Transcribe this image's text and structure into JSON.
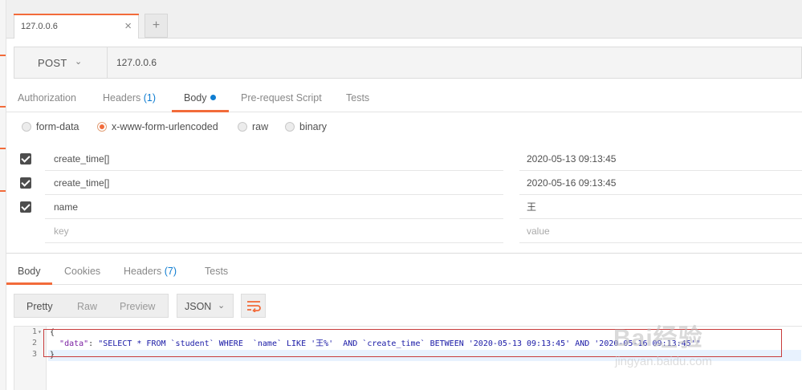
{
  "tabbar": {
    "active_tab": "127.0.0.6",
    "close_glyph": "×",
    "new_tab_glyph": "+"
  },
  "request": {
    "method": "POST",
    "url": "127.0.0.6",
    "tabs": [
      {
        "label": "Authorization"
      },
      {
        "label": "Headers",
        "count": "(1)"
      },
      {
        "label": "Body",
        "active": true
      },
      {
        "label": "Pre-request Script"
      },
      {
        "label": "Tests"
      }
    ],
    "body_types": [
      {
        "label": "form-data",
        "selected": false
      },
      {
        "label": "x-www-form-urlencoded",
        "selected": true
      },
      {
        "label": "raw",
        "selected": false
      },
      {
        "label": "binary",
        "selected": false
      }
    ],
    "params": [
      {
        "checked": true,
        "key": "create_time[]",
        "value": "2020-05-13 09:13:45"
      },
      {
        "checked": true,
        "key": "create_time[]",
        "value": "2020-05-16 09:13:45"
      },
      {
        "checked": true,
        "key": "name",
        "value": "王"
      }
    ],
    "new_param": {
      "key_placeholder": "key",
      "value_placeholder": "value"
    }
  },
  "response": {
    "tabs": [
      {
        "label": "Body",
        "active": true
      },
      {
        "label": "Cookies"
      },
      {
        "label": "Headers",
        "count": "(7)"
      },
      {
        "label": "Tests"
      }
    ],
    "formats": [
      "Pretty",
      "Raw",
      "Preview"
    ],
    "active_format": "Pretty",
    "language": "JSON",
    "line_numbers": [
      "1",
      "2",
      "3"
    ],
    "code": {
      "open": "{",
      "key": "\"data\"",
      "colon": ": ",
      "value": "\"SELECT * FROM `student` WHERE  `name` LIKE '王%'  AND `create_time` BETWEEN '2020-05-13 09:13:45' AND '2020-05-16 09:13:45'\"",
      "close": "}"
    }
  },
  "watermark": {
    "text": "Bai经验",
    "url": "jingyan.baidu.com"
  },
  "colors": {
    "accent": "#f26b3a",
    "link_blue": "#0f7dd1",
    "highlight": "#c83c3c"
  },
  "icons": [
    "close-icon",
    "plus-icon",
    "chevron-down-icon",
    "wrap-lines-icon",
    "fold-arrow-icon",
    "checkbox-checked-icon"
  ]
}
